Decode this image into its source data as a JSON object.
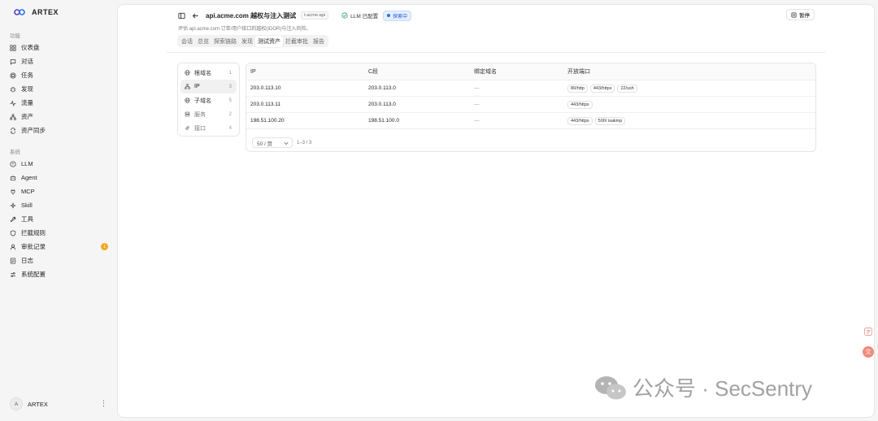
{
  "brand": {
    "name": "ARTEX"
  },
  "sidebar": {
    "section_features": "功能",
    "features": [
      {
        "label": "仪表盘",
        "icon": "dashboard-icon"
      },
      {
        "label": "对话",
        "icon": "chat-icon"
      },
      {
        "label": "任务",
        "icon": "target-icon"
      },
      {
        "label": "发现",
        "icon": "bug-icon"
      },
      {
        "label": "流量",
        "icon": "activity-icon"
      },
      {
        "label": "资产",
        "icon": "network-icon"
      },
      {
        "label": "资产同步",
        "icon": "sync-icon"
      }
    ],
    "section_system": "系统",
    "system": [
      {
        "label": "LLM",
        "icon": "llm-icon"
      },
      {
        "label": "Agent",
        "icon": "bot-icon"
      },
      {
        "label": "MCP",
        "icon": "plug-icon"
      },
      {
        "label": "Skill",
        "icon": "sparkle-icon"
      },
      {
        "label": "工具",
        "icon": "wrench-icon"
      },
      {
        "label": "拦截规则",
        "icon": "shield-icon"
      },
      {
        "label": "审批记录",
        "icon": "approval-icon",
        "badge": "1"
      },
      {
        "label": "日志",
        "icon": "log-icon"
      },
      {
        "label": "系统配置",
        "icon": "settings-icon"
      }
    ],
    "user": {
      "initial": "A",
      "name": "ARTEX",
      "menu": "⋮"
    }
  },
  "header": {
    "title": "api.acme.com 越权与注入测试",
    "project_tag": "t-acme-api",
    "llm_status": "LLM 已配置",
    "state_badge": "探索中",
    "pause_label": "暂停",
    "subtitle": "评估 api.acme.com 订单/用户接口的越权(IDOR)与注入风险。"
  },
  "tabs": [
    "会话",
    "总览",
    "探索链路",
    "发现",
    "测试资产",
    "拦截审批",
    "报告"
  ],
  "active_tab": "测试资产",
  "asset_types": [
    {
      "label": "根域名",
      "count": "1",
      "icon": "globe-icon"
    },
    {
      "label": "IP",
      "count": "3",
      "icon": "network-icon"
    },
    {
      "label": "子域名",
      "count": "5",
      "icon": "globe-icon"
    },
    {
      "label": "服务",
      "count": "2",
      "icon": "server-icon"
    },
    {
      "label": "接口",
      "count": "4",
      "icon": "link-icon"
    }
  ],
  "table": {
    "headers": [
      "IP",
      "C段",
      "绑定域名",
      "开放端口"
    ],
    "rows": [
      {
        "ip": "203.0.113.10",
        "c_segment": "203.0.113.0",
        "domain": "—",
        "ports": [
          "80/http",
          "443/https",
          "22/ssh"
        ]
      },
      {
        "ip": "203.0.113.11",
        "c_segment": "203.0.113.0",
        "domain": "—",
        "ports": [
          "443/https"
        ]
      },
      {
        "ip": "198.51.100.20",
        "c_segment": "198.51.100.0",
        "domain": "—",
        "ports": [
          "443/https",
          "500/ isakmp"
        ]
      }
    ],
    "page_size": "50 / 页",
    "page_info": "1–3 / 3"
  },
  "watermark": {
    "text": "公众号 · SecSentry"
  },
  "colors": {
    "badge_orange": "#f5a623",
    "accent_blue": "#2f6fe4",
    "float_red": "#f08a7d"
  }
}
